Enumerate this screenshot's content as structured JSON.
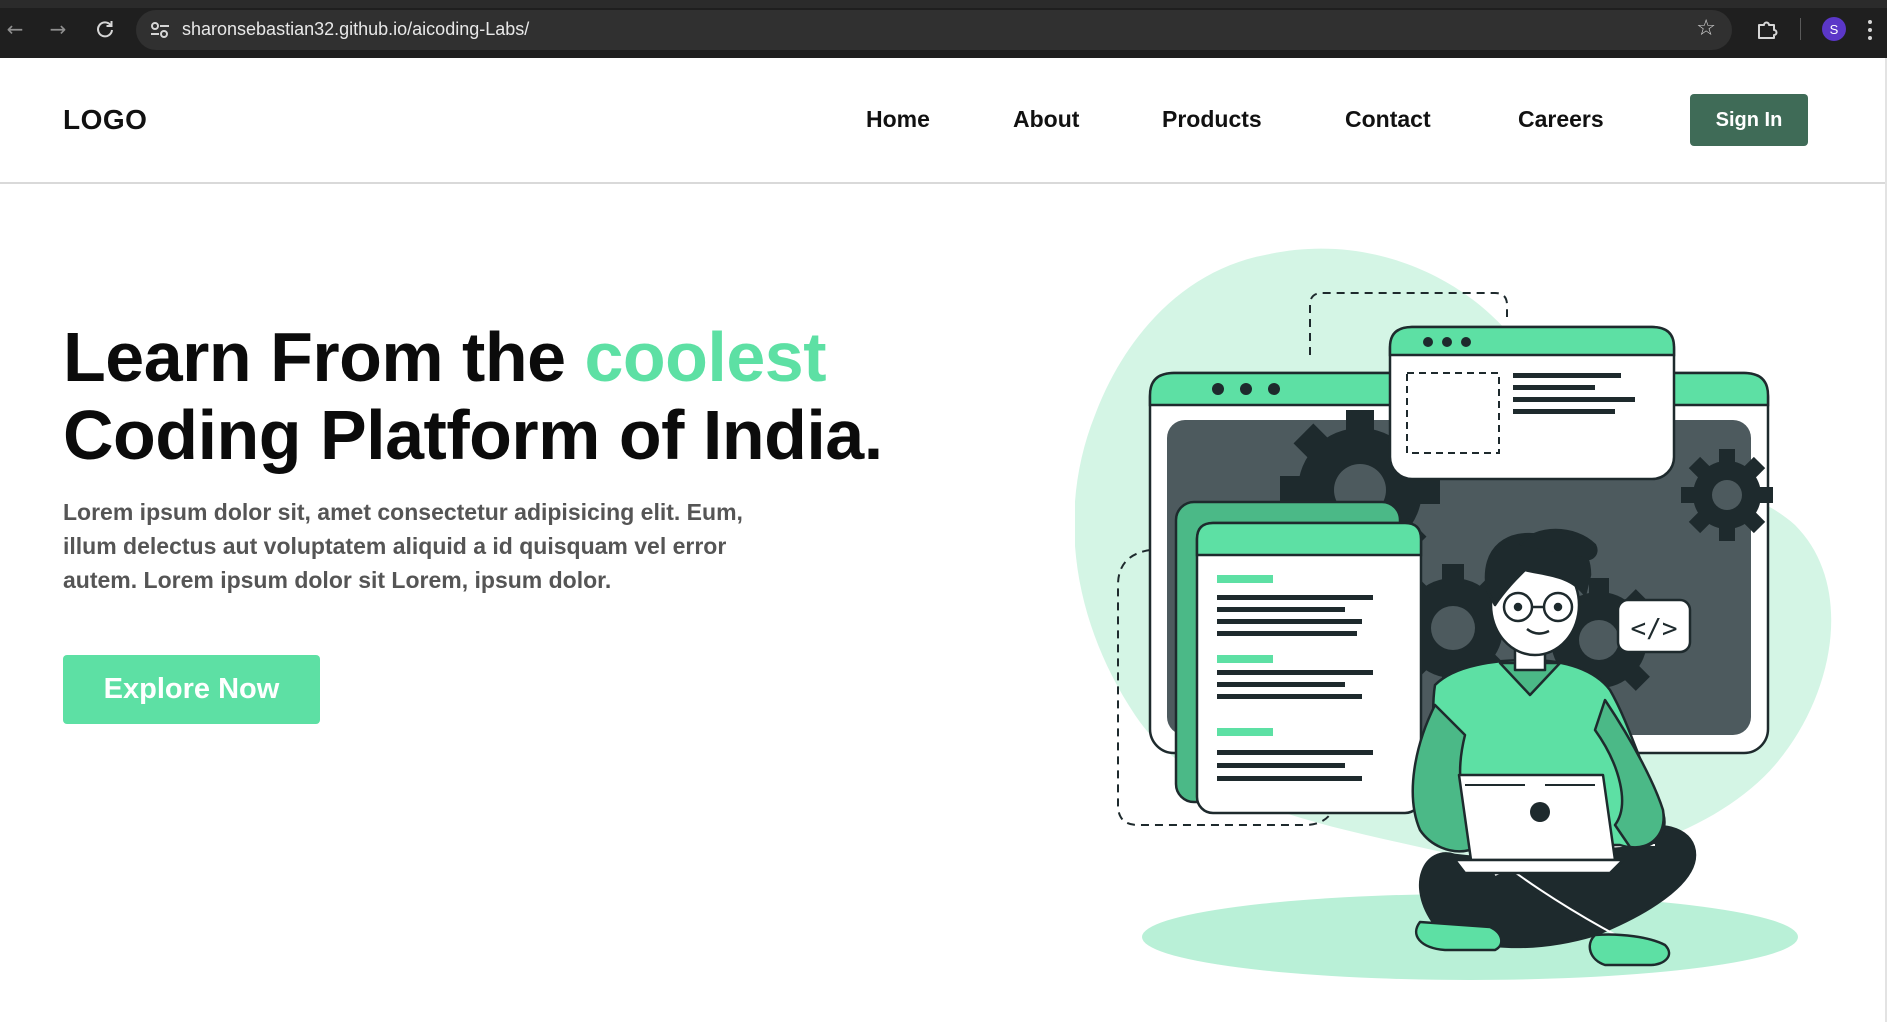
{
  "browser": {
    "url": "sharonsebastian32.github.io/aicoding-Labs/",
    "profile_initial": "S",
    "icons": {
      "back": "arrow-left-icon",
      "forward": "arrow-right-icon",
      "reload": "reload-icon",
      "site_info": "tune-icon",
      "bookmark": "star-icon",
      "extensions": "puzzle-icon",
      "menu": "kebab-menu-icon"
    }
  },
  "header": {
    "logo": "LOGO",
    "nav": [
      "Home",
      "About",
      "Products",
      "Contact",
      "Careers"
    ],
    "signin_label": "Sign In"
  },
  "hero": {
    "title_line1_start": "Learn From the ",
    "title_accent": "coolest",
    "title_line2": "Coding Platform of India.",
    "description": "Lorem ipsum dolor sit, amet consectetur adipisicing elit. Eum, illum delectus aut voluptatem aliquid a id quisquam vel error autem. Lorem ipsum dolor sit Lorem, ipsum dolor.",
    "cta_label": "Explore Now",
    "illustration_code_tag": "</>"
  },
  "colors": {
    "accent": "#5de0a4",
    "signin_bg": "#3f6b57",
    "dark": "#1e2a2d"
  }
}
